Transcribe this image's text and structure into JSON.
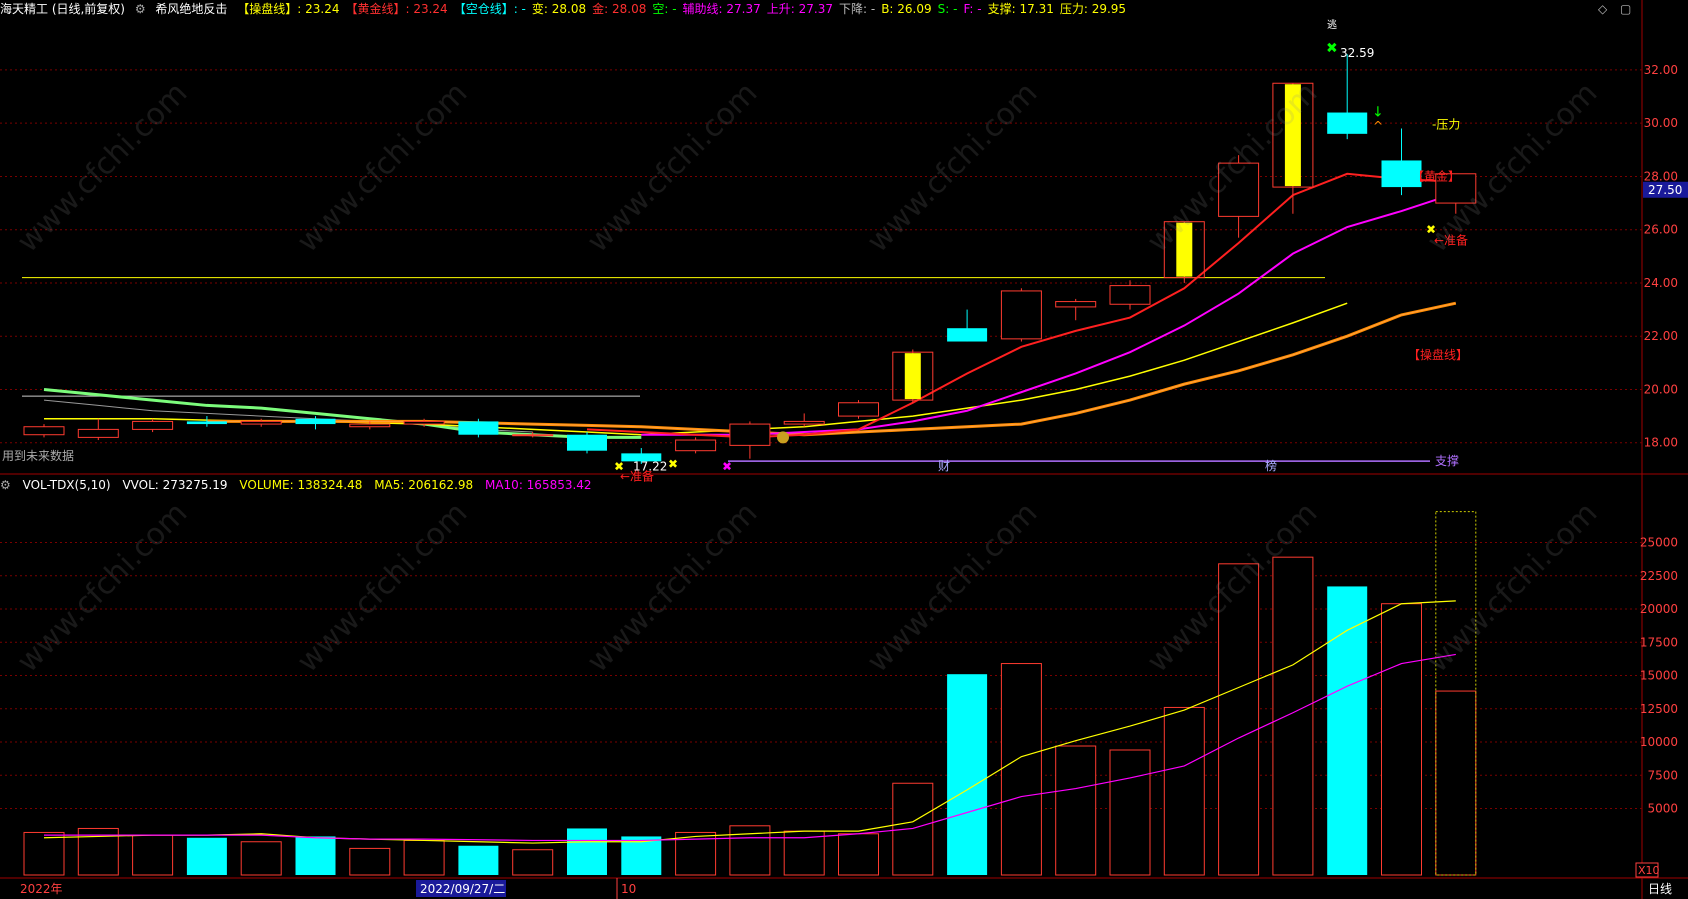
{
  "header": {
    "stock_name": "海天精工 (日线,前复权)",
    "formula_name": "希风绝地反击",
    "items": [
      {
        "label": "【操盘线】",
        "value": ": 23.24",
        "color": "#ffff00"
      },
      {
        "label": "【黄金线】",
        "value": ": 23.24",
        "color": "#ff3030"
      },
      {
        "label": "【空仓线】",
        "value": ": -",
        "color": "#00ffff"
      },
      {
        "label": "变:",
        "value": " 28.08",
        "color": "#ffff00"
      },
      {
        "label": "金:",
        "value": " 28.08",
        "color": "#ff3030"
      },
      {
        "label": "空:",
        "value": " -",
        "color": "#00ff00"
      },
      {
        "label": "辅助线:",
        "value": " 27.37",
        "color": "#ff00ff"
      },
      {
        "label": "上升:",
        "value": " 27.37",
        "color": "#ff00ff"
      },
      {
        "label": "下降:",
        "value": " -",
        "color": "#bbbbbb"
      },
      {
        "label": "B:",
        "value": " 26.09",
        "color": "#ffff00"
      },
      {
        "label": "S:",
        "value": " -",
        "color": "#00ff00"
      },
      {
        "label": "F:",
        "value": " -",
        "color": "#ff00ff"
      },
      {
        "label": "支撑:",
        "value": " 17.31",
        "color": "#ffff00"
      },
      {
        "label": "压力:",
        "value": " 29.95",
        "color": "#ffff00"
      }
    ]
  },
  "volume_header": {
    "name": "VOL-TDX(5,10)",
    "vvol": "VVOL: 273275.19",
    "volume": "VOLUME: 138324.48",
    "ma5": "MA5: 206162.98",
    "ma10": "MA10: 165853.42"
  },
  "labels": {
    "future_data": "用到未来数据",
    "support": "支撑",
    "pressure": "-压力",
    "zhunbei": "←准备",
    "caopan": "【操盘线】",
    "jin": "【黄金】",
    "high_val": "32.59",
    "low_val": "17.22",
    "mark_cai": "财",
    "mark_bang": "榜",
    "mark_zhi": "逃",
    "current_price": "27.50",
    "vol_unit": "X10",
    "period": "日线",
    "date_2022": "2022年",
    "date_sel": "2022/09/27/二",
    "date_10": "10"
  },
  "colors": {
    "up": "#ff3b30",
    "down": "#00ffff",
    "yellow": "#ffff00",
    "red": "#ff2020",
    "magenta": "#ff00ff",
    "orange": "#ff8c00",
    "grid": "#7a0000",
    "support": "#b070ff"
  },
  "chart_data": [
    {
      "type": "candlestick",
      "y_ticks": [
        18,
        20,
        22,
        24,
        26,
        28,
        30,
        32
      ],
      "ylim": [
        16.9,
        33.8
      ],
      "candles": [
        {
          "o": 18.3,
          "h": 18.7,
          "l": 18.2,
          "c": 18.6
        },
        {
          "o": 18.2,
          "h": 18.9,
          "l": 18.1,
          "c": 18.5
        },
        {
          "o": 18.5,
          "h": 18.9,
          "l": 18.4,
          "c": 18.8
        },
        {
          "o": 18.8,
          "h": 19.0,
          "l": 18.6,
          "c": 18.7
        },
        {
          "o": 18.7,
          "h": 18.9,
          "l": 18.6,
          "c": 18.8
        },
        {
          "o": 18.9,
          "h": 19.0,
          "l": 18.5,
          "c": 18.7
        },
        {
          "o": 18.6,
          "h": 18.8,
          "l": 18.5,
          "c": 18.7
        },
        {
          "o": 18.7,
          "h": 18.9,
          "l": 18.6,
          "c": 18.8
        },
        {
          "o": 18.8,
          "h": 18.9,
          "l": 18.2,
          "c": 18.3
        },
        {
          "o": 18.3,
          "h": 18.4,
          "l": 18.2,
          "c": 18.3
        },
        {
          "o": 18.3,
          "h": 18.4,
          "l": 17.6,
          "c": 17.7
        },
        {
          "o": 17.6,
          "h": 17.8,
          "l": 17.2,
          "c": 17.3
        },
        {
          "o": 17.7,
          "h": 18.2,
          "l": 17.6,
          "c": 18.1
        },
        {
          "o": 17.9,
          "h": 18.8,
          "l": 17.4,
          "c": 18.7
        },
        {
          "o": 18.7,
          "h": 19.1,
          "l": 18.6,
          "c": 18.8
        },
        {
          "o": 19.0,
          "h": 19.6,
          "l": 18.9,
          "c": 19.5
        },
        {
          "o": 19.6,
          "h": 21.5,
          "l": 19.5,
          "c": 21.4
        },
        {
          "o": 22.3,
          "h": 23.0,
          "l": 21.8,
          "c": 21.8
        },
        {
          "o": 21.9,
          "h": 23.8,
          "l": 21.8,
          "c": 23.7
        },
        {
          "o": 23.1,
          "h": 23.4,
          "l": 22.6,
          "c": 23.3
        },
        {
          "o": 23.2,
          "h": 24.1,
          "l": 23.0,
          "c": 23.9
        },
        {
          "o": 24.2,
          "h": 26.3,
          "l": 24.0,
          "c": 26.3
        },
        {
          "o": 26.5,
          "h": 28.8,
          "l": 25.7,
          "c": 28.5
        },
        {
          "o": 27.6,
          "h": 31.5,
          "l": 26.6,
          "c": 31.5
        },
        {
          "o": 30.4,
          "h": 32.59,
          "l": 29.4,
          "c": 29.6
        },
        {
          "o": 28.6,
          "h": 29.8,
          "l": 27.3,
          "c": 27.6
        },
        {
          "o": 27.0,
          "h": 28.1,
          "l": 26.6,
          "c": 28.1
        }
      ],
      "hollow_special": [
        13,
        15,
        18,
        19,
        20,
        22,
        25,
        26
      ],
      "yellow_filled": [
        16,
        21,
        23
      ],
      "lines": {
        "caopan": [
          18.8,
          18.8,
          18.8,
          18.8,
          18.8,
          18.75,
          18.7,
          18.65,
          18.6,
          18.5,
          18.4,
          18.3,
          18.4,
          18.5,
          18.6,
          18.7,
          19.1,
          19.6,
          20.2,
          20.7,
          21.3,
          22.0,
          22.8,
          23.24
        ],
        "jin": [
          18.8,
          18.8,
          18.8,
          18.8,
          18.8,
          18.75,
          18.7,
          18.65,
          18.6,
          18.5,
          18.4,
          18.3,
          18.4,
          18.5,
          18.6,
          18.7,
          19.1,
          19.6,
          20.2,
          20.7,
          21.3,
          22.0,
          22.8,
          23.24
        ],
        "yellow_slow": [
          18.9,
          18.9,
          18.9,
          18.85,
          18.8,
          18.8,
          18.75,
          18.7,
          18.6,
          18.5,
          18.4,
          18.3,
          18.4,
          18.5,
          18.6,
          18.8,
          19.0,
          19.3,
          19.6,
          20.0,
          20.5,
          21.1,
          21.8,
          22.5,
          23.24
        ],
        "red_fast": [
          18.5,
          18.4,
          18.3,
          18.2,
          18.3,
          18.5,
          19.5,
          20.6,
          21.6,
          22.2,
          22.7,
          23.8,
          25.5,
          27.3,
          28.1,
          27.9,
          27.8
        ],
        "magenta": [
          18.3,
          18.3,
          18.3,
          18.4,
          18.5,
          18.8,
          19.2,
          19.9,
          20.6,
          21.4,
          22.4,
          23.6,
          25.1,
          26.1,
          26.7,
          27.37
        ],
        "green": [
          20.0,
          19.8,
          19.6,
          19.4,
          19.3,
          19.1,
          18.9,
          18.7,
          18.4,
          18.3,
          18.2,
          18.2
        ],
        "gray": [
          19.6,
          19.4,
          19.2,
          19.1,
          19.0,
          18.9,
          18.8,
          18.7,
          18.5,
          18.4
        ],
        "yellow_hline": 24.2,
        "support": 17.31,
        "white_hline": 19.75
      }
    },
    {
      "type": "bar",
      "name": "VOL-TDX(5,10)",
      "y_ticks": [
        5000,
        7500,
        10000,
        12500,
        15000,
        17500,
        20000,
        22500,
        25000
      ],
      "ylim": [
        0,
        28500
      ],
      "unit": "X10",
      "values": [
        3200,
        3500,
        3000,
        2800,
        2500,
        2900,
        2000,
        2600,
        2200,
        1900,
        3500,
        2900,
        3200,
        3700,
        3300,
        3100,
        6900,
        15100,
        15900,
        9700,
        9400,
        12600,
        23400,
        23900,
        21700,
        20400,
        13832
      ],
      "predicted_top": 27327,
      "ma5": [
        2800,
        2900,
        3000,
        3000,
        3100,
        2800,
        2700,
        2600,
        2500,
        2400,
        2500,
        2500,
        2900,
        3100,
        3300,
        3300,
        4000,
        6400,
        8900,
        10100,
        11200,
        12400,
        14100,
        15800,
        18400,
        20400,
        20616
      ],
      "ma10": [
        3000,
        3000,
        3000,
        3000,
        3000,
        2800,
        2700,
        2700,
        2650,
        2600,
        2600,
        2600,
        2700,
        2800,
        2800,
        3100,
        3500,
        4700,
        5900,
        6500,
        7300,
        8200,
        10300,
        12200,
        14200,
        15900,
        16585
      ]
    }
  ]
}
